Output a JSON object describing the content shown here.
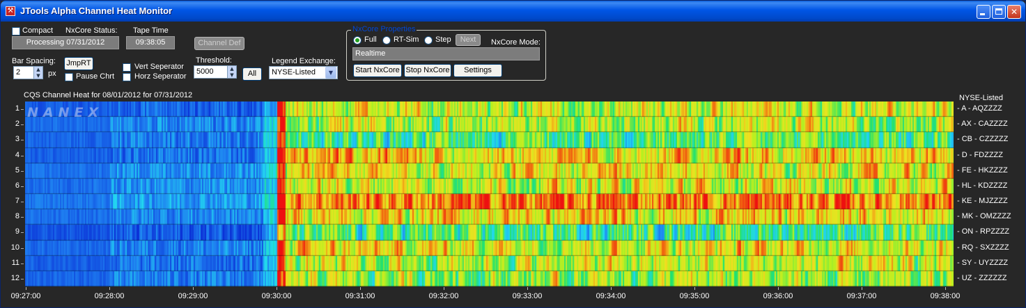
{
  "window": {
    "title": "JTools Alpha Channel Heat Monitor",
    "icon": "app-logo-icon"
  },
  "controls": {
    "compact_label": "Compact",
    "compact_checked": false,
    "nxcore_status_label": "NxCore Status:",
    "nxcore_status_value": "Processing 07/31/2012",
    "tape_time_label": "Tape Time",
    "tape_time_value": "09:38:05",
    "channel_def_label": "Channel Def",
    "bar_spacing_label": "Bar Spacing:",
    "bar_spacing_value": "2",
    "bar_spacing_unit": "px",
    "jmprt_label": "JmpRT",
    "pause_chart_label": "Pause Chrt",
    "vert_separator_label": "Vert Seperator",
    "horz_separator_label": "Horz Seperator",
    "threshold_label": "Threshold:",
    "threshold_value": "5000",
    "all_label": "All",
    "legend_exchange_label": "Legend Exchange:",
    "legend_exchange_value": "NYSE-Listed"
  },
  "nxcore_group": {
    "title": "NxCore Properties",
    "full_label": "Full",
    "rtsim_label": "RT-Sim",
    "step_label": "Step",
    "next_label": "Next",
    "mode_label": "NxCore Mode:",
    "mode_value": "Realtime",
    "start_label": "Start NxCore",
    "stop_label": "Stop NxCore",
    "settings_label": "Settings",
    "selected_mode": "Full"
  },
  "chart_data": {
    "type": "heatmap",
    "title": "CQS Channel Heat for 08/01/2012 for 07/31/2012",
    "legend_title": "NYSE-Listed",
    "watermark": "NANEX",
    "rows": [
      "1",
      "2",
      "3",
      "4",
      "5",
      "6",
      "7",
      "8",
      "9",
      "10",
      "11",
      "12"
    ],
    "row_labels": [
      "A - AQZZZZ",
      "AX - CAZZZZ",
      "CB - CZZZZZ",
      "D - FDZZZZ",
      "FE - HKZZZZ",
      "HL - KDZZZZ",
      "KE - MJZZZZ",
      "MK - OMZZZZ",
      "ON - RPZZZZ",
      "RQ - SXZZZZ",
      "SY - UYZZZZ",
      "UZ - ZZZZZZ"
    ],
    "x_ticks": [
      "09:27:00",
      "09:28:00",
      "09:29:00",
      "09:30:00",
      "09:31:00",
      "09:32:00",
      "09:33:00",
      "09:34:00",
      "09:35:00",
      "09:36:00",
      "09:37:00",
      "09:38:00"
    ],
    "x_range": [
      "09:27:00",
      "09:38:05"
    ],
    "color_scale": [
      "#0a2fd6",
      "#1e7df0",
      "#22d8f0",
      "#20e070",
      "#b8f020",
      "#f0e020",
      "#f07010",
      "#ee1010"
    ],
    "row_heat_level_after_open": [
      0.62,
      0.58,
      0.45,
      0.72,
      0.66,
      0.64,
      0.85,
      0.7,
      0.42,
      0.68,
      0.6,
      0.55
    ],
    "row_heat_level_pre_open": [
      0.08,
      0.14,
      0.12,
      0.1,
      0.16,
      0.15,
      0.18,
      0.14,
      0.06,
      0.13,
      0.1,
      0.12
    ]
  }
}
